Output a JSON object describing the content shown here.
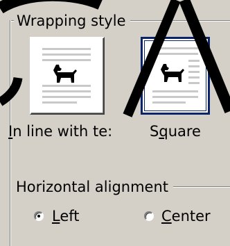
{
  "wrapping_style": {
    "title": "Wrapping style",
    "options": [
      {
        "label_first": "I",
        "label_rest": "n line with te:",
        "icon": "dog-silhouette-icon",
        "selected": false
      },
      {
        "label_before": "S",
        "label_u": "q",
        "label_after": "uare",
        "icon": "dog-silhouette-icon",
        "selected": true
      }
    ]
  },
  "horizontal_alignment": {
    "title": "Horizontal alignment",
    "left": {
      "u": "L",
      "rest": "eft",
      "selected": true
    },
    "center": {
      "u": "C",
      "rest": "enter",
      "selected": false
    }
  },
  "colors": {
    "dialog_bg": "#d4d0c8",
    "selection": "#0a246a",
    "watermark": "#000000"
  }
}
